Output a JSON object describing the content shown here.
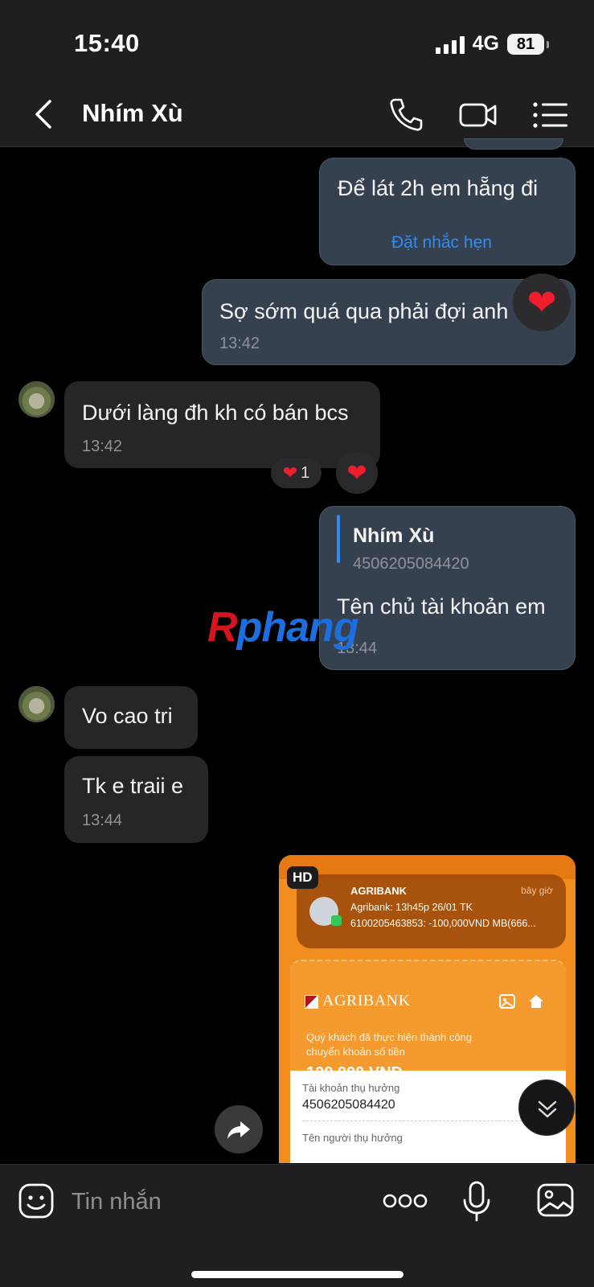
{
  "status": {
    "time": "15:40",
    "network": "4G",
    "battery": "81"
  },
  "header": {
    "title": "Nhím Xù"
  },
  "messages": {
    "m1": {
      "text": "Để lát 2h em hẵng đi",
      "action": "Đặt nhắc hẹn"
    },
    "m2": {
      "text": "Sợ sớm quá qua phải đợi anh",
      "time": "13:42",
      "reaction": "❤️"
    },
    "m3": {
      "text": "Dưới làng đh kh có bán bcs",
      "time": "13:42",
      "reaction_count": "1"
    },
    "m4": {
      "quote_name": "Nhím Xù",
      "quote_text": "4506205084420",
      "text": "Tên chủ tài khoản em",
      "time": "13:44"
    },
    "m5": {
      "text": "Vo cao tri"
    },
    "m6": {
      "text": "Tk e traii e",
      "time": "13:44"
    }
  },
  "watermark": {
    "r": "R",
    "rest": "phang"
  },
  "image_message": {
    "badge": "HD",
    "notification": {
      "app": "AGRIBANK",
      "time": "bây giờ",
      "line1": "Agribank: 13h45p 26/01 TK",
      "line2": "6100205463853: -100,000VND  MB(666..."
    },
    "bank": "AGRIBANK",
    "line1": "Quý khách đã thực hiện thành công",
    "line2": "chuyển khoản số tiền",
    "amount": "100,000 VND",
    "label_account": "Tài khoản thụ hưởng",
    "account": "4506205084420",
    "label_name": "Tên người thụ hưởng"
  },
  "composer": {
    "placeholder": "Tin nhắn"
  },
  "colors": {
    "accent": "#2f8cf4",
    "heart": "#f01e2c",
    "outgoing_bubble": "#364150",
    "incoming_bubble": "#262628"
  }
}
